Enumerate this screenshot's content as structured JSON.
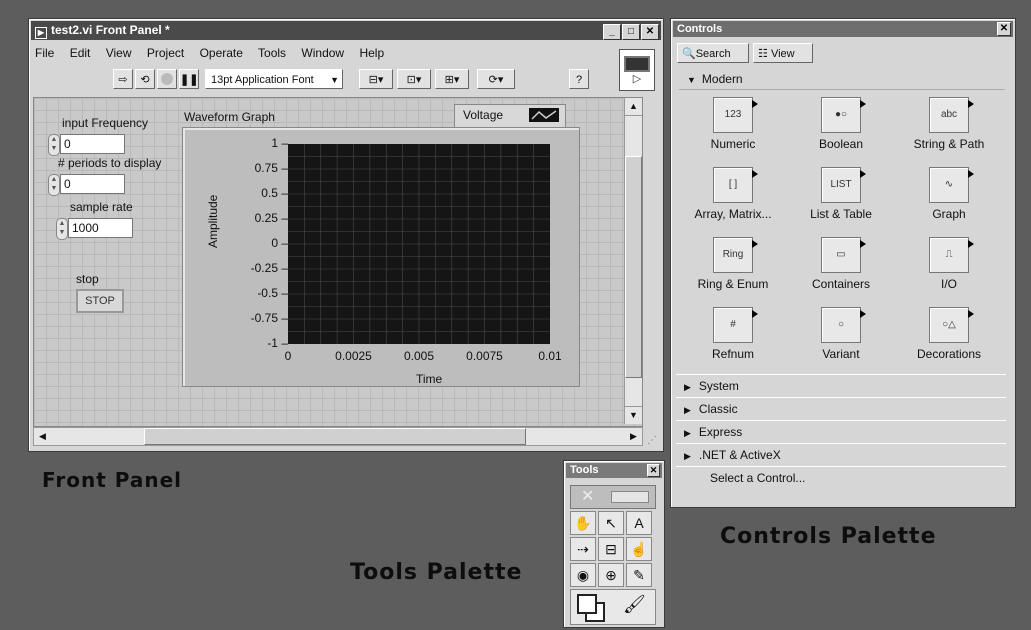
{
  "front_panel": {
    "title": "test2.vi Front Panel *",
    "menu": [
      "File",
      "Edit",
      "View",
      "Project",
      "Operate",
      "Tools",
      "Window",
      "Help"
    ],
    "font_select": "13pt Application Font",
    "controls": {
      "input_frequency_label": "input Frequency",
      "input_frequency_value": "0",
      "periods_label": "# periods to display",
      "periods_value": "0",
      "sample_rate_label": "sample rate",
      "sample_rate_value": "1000",
      "stop_label": "stop",
      "stop_button": "STOP"
    },
    "graph": {
      "title": "Waveform Graph",
      "legend": "Voltage",
      "ylabel": "Amplitude",
      "xlabel": "Time",
      "yticks": [
        "1",
        "0.75",
        "0.5",
        "0.25",
        "0",
        "-0.25",
        "-0.5",
        "-0.75",
        "-1"
      ],
      "xticks": [
        "0",
        "0.0025",
        "0.005",
        "0.0075",
        "0.01"
      ]
    }
  },
  "controls_palette": {
    "title": "Controls",
    "search": "Search",
    "view": "View",
    "section": "Modern",
    "items": [
      {
        "name": "Numeric",
        "glyph": "123"
      },
      {
        "name": "Boolean",
        "glyph": "●○"
      },
      {
        "name": "String & Path",
        "glyph": "abc"
      },
      {
        "name": "Array, Matrix...",
        "glyph": "[ ]"
      },
      {
        "name": "List & Table",
        "glyph": "LIST"
      },
      {
        "name": "Graph",
        "glyph": "∿"
      },
      {
        "name": "Ring & Enum",
        "glyph": "Ring"
      },
      {
        "name": "Containers",
        "glyph": "▭"
      },
      {
        "name": "I/O",
        "glyph": "⎍"
      },
      {
        "name": "Refnum",
        "glyph": "#"
      },
      {
        "name": "Variant",
        "glyph": "○"
      },
      {
        "name": "Decorations",
        "glyph": "○△"
      }
    ],
    "categories": [
      "System",
      "Classic",
      "Express",
      ".NET & ActiveX"
    ],
    "select": "Select a Control..."
  },
  "tools_palette": {
    "title": "Tools",
    "tools": [
      "✋",
      "↖",
      "A",
      "⇢",
      "⊟",
      "☝",
      "◉",
      "⊕",
      "✎"
    ]
  },
  "captions": {
    "front_panel": "Front Panel",
    "tools_palette": "Tools Palette",
    "controls_palette": "Controls Palette"
  },
  "colors": {
    "plot_bg": "#151515",
    "grid": "#4a4a4a"
  }
}
